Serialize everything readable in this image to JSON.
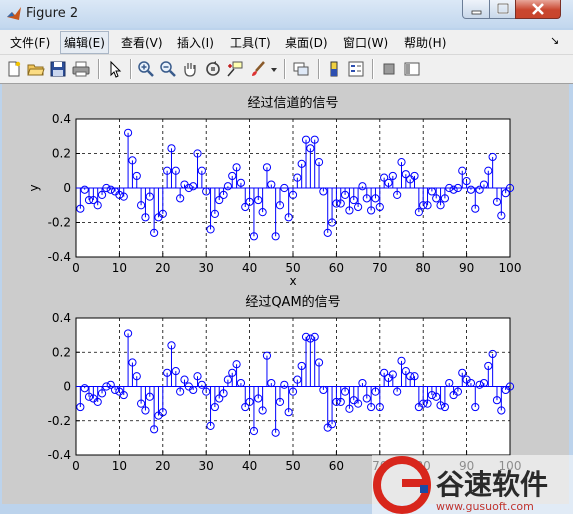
{
  "window": {
    "title": "Figure 2"
  },
  "menu": [
    "文件(F)",
    "编辑(E)",
    "查看(V)",
    "插入(I)",
    "工具(T)",
    "桌面(D)",
    "窗口(W)",
    "帮助(H)"
  ],
  "menu_arrow": "↘",
  "toolbar_icons": [
    "new-figure-icon",
    "open-file-icon",
    "save-icon",
    "print-icon",
    "pointer-icon",
    "zoom-in-icon",
    "zoom-out-icon",
    "pan-icon",
    "rotate-3d-icon",
    "data-cursor-icon",
    "brush-icon",
    "brush-dropdown-icon",
    "link-plot-icon",
    "colorbar-icon",
    "legend-icon",
    "hide-plot-tools-icon",
    "show-plot-tools-icon"
  ],
  "colors": {
    "stem": "#0000ff",
    "axes_bg": "#ffffff",
    "figure_bg": "#cccccc"
  },
  "watermark": {
    "brand": "谷速软件",
    "url": "www.gusuoft.com"
  },
  "chart_data": [
    {
      "type": "stem",
      "title": "经过信道的信号",
      "xlabel": "x",
      "ylabel": "y",
      "xlim": [
        0,
        100
      ],
      "ylim": [
        -0.4,
        0.4
      ],
      "xticks": [
        "0",
        "10",
        "20",
        "30",
        "40",
        "50",
        "60",
        "70",
        "80",
        "90",
        "100"
      ],
      "yticks": [
        "0.4",
        "0.2",
        "0",
        "-0.2",
        "-0.4"
      ],
      "grid": true,
      "x_start": 1,
      "values": [
        -0.12,
        -0.01,
        -0.07,
        -0.07,
        -0.1,
        -0.04,
        0.0,
        -0.01,
        -0.02,
        -0.04,
        -0.05,
        0.32,
        0.16,
        0.07,
        -0.1,
        -0.17,
        -0.05,
        -0.26,
        -0.17,
        -0.15,
        0.1,
        0.23,
        0.1,
        -0.06,
        0.02,
        0.0,
        0.01,
        0.2,
        0.1,
        -0.02,
        -0.24,
        -0.15,
        -0.07,
        -0.04,
        0.01,
        0.07,
        0.12,
        0.03,
        -0.11,
        -0.08,
        -0.28,
        -0.07,
        -0.14,
        0.12,
        0.02,
        -0.28,
        -0.1,
        0.0,
        -0.17,
        -0.04,
        0.06,
        0.14,
        0.28,
        0.23,
        0.28,
        0.15,
        -0.02,
        -0.26,
        -0.2,
        -0.09,
        -0.09,
        -0.04,
        -0.13,
        -0.07,
        -0.11,
        0.01,
        -0.06,
        -0.13,
        -0.06,
        -0.11,
        0.06,
        0.03,
        0.07,
        -0.04,
        0.15,
        0.08,
        0.05,
        0.07,
        -0.14,
        -0.1,
        -0.1,
        -0.02,
        -0.06,
        -0.1,
        -0.06,
        0.0,
        -0.01,
        0.0,
        0.1,
        0.04,
        -0.01,
        -0.12,
        -0.01,
        0.02,
        0.1,
        0.18,
        -0.08,
        -0.16,
        -0.03,
        0.0
      ]
    },
    {
      "type": "stem",
      "title": "经过QAM的信号",
      "xlim": [
        0,
        100
      ],
      "ylim": [
        -0.4,
        0.4
      ],
      "xticks": [
        "0",
        "10",
        "20",
        "30",
        "40",
        "50",
        "60",
        "70",
        "80",
        "90",
        "100"
      ],
      "yticks": [
        "0.4",
        "0.2",
        "0",
        "-0.2",
        "-0.4"
      ],
      "grid": true,
      "x_start": 1,
      "values": [
        -0.12,
        -0.01,
        -0.06,
        -0.07,
        -0.09,
        -0.04,
        0.0,
        0.01,
        -0.02,
        -0.03,
        -0.05,
        0.31,
        0.14,
        0.06,
        -0.1,
        -0.14,
        -0.06,
        -0.25,
        -0.17,
        -0.15,
        0.08,
        0.24,
        0.09,
        -0.03,
        0.04,
        0.0,
        -0.02,
        0.06,
        0.01,
        -0.03,
        -0.23,
        -0.12,
        -0.07,
        -0.04,
        0.04,
        0.08,
        0.13,
        0.02,
        -0.12,
        -0.09,
        -0.26,
        -0.07,
        -0.14,
        0.18,
        0.02,
        -0.27,
        -0.09,
        0.01,
        -0.15,
        -0.03,
        0.04,
        0.12,
        0.29,
        0.28,
        0.29,
        0.14,
        -0.02,
        -0.24,
        -0.22,
        -0.09,
        -0.09,
        -0.03,
        -0.13,
        -0.08,
        -0.1,
        0.02,
        -0.07,
        -0.12,
        -0.03,
        -0.12,
        0.08,
        0.05,
        0.07,
        -0.03,
        0.15,
        0.09,
        0.06,
        0.06,
        -0.12,
        -0.1,
        -0.1,
        -0.05,
        -0.06,
        -0.11,
        -0.12,
        0.02,
        -0.05,
        -0.03,
        0.08,
        0.04,
        0.02,
        -0.12,
        0.01,
        0.02,
        0.12,
        0.19,
        -0.08,
        -0.14,
        -0.02,
        0.0
      ]
    }
  ]
}
